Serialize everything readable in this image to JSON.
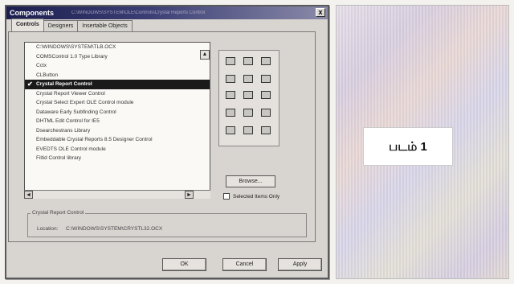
{
  "dialog": {
    "title": "Components",
    "title_path": "C:\\WINDOWS\\SYSTEM\\OLE\\Controls\\Crystal Reports Control",
    "close_label": "x",
    "tabs": [
      {
        "label": "Controls"
      },
      {
        "label": "Designers"
      },
      {
        "label": "Insertable Objects"
      }
    ],
    "list_items": [
      {
        "label": "C:\\WINDOWS\\SYSTEM\\TLB.OCX",
        "checked": false
      },
      {
        "label": "COMSControl 1.0 Type Library",
        "checked": false
      },
      {
        "label": "Cctx",
        "checked": false
      },
      {
        "label": "CLButton",
        "checked": false
      },
      {
        "label": "Crystal Report Control",
        "checked": true
      },
      {
        "label": "Crystal Report Viewer Control",
        "checked": false
      },
      {
        "label": "Crystal Select Expert OLE Control module",
        "checked": false
      },
      {
        "label": "Dataware Early Subfinding Control",
        "checked": false
      },
      {
        "label": "DHTML Edit Control for IE5",
        "checked": false
      },
      {
        "label": "Dsearchestrans Library",
        "checked": false
      },
      {
        "label": "Embeddable Crystal Reports 8.5 Designer Control",
        "checked": false
      },
      {
        "label": "EVEDTS OLE Control module",
        "checked": false
      },
      {
        "label": "Filtid Control library",
        "checked": false
      }
    ],
    "browse_label": "Browse...",
    "selected_items_only_label": "Selected Items Only",
    "info": {
      "name": "Crystal Report Control",
      "location_label": "Location:",
      "location_path": "C:\\WINDOWS\\SYSTEM\\CRYSTL32.OCX"
    },
    "buttons": {
      "ok": "OK",
      "cancel": "Cancel",
      "apply": "Apply"
    }
  },
  "caption": "படம் 1"
}
